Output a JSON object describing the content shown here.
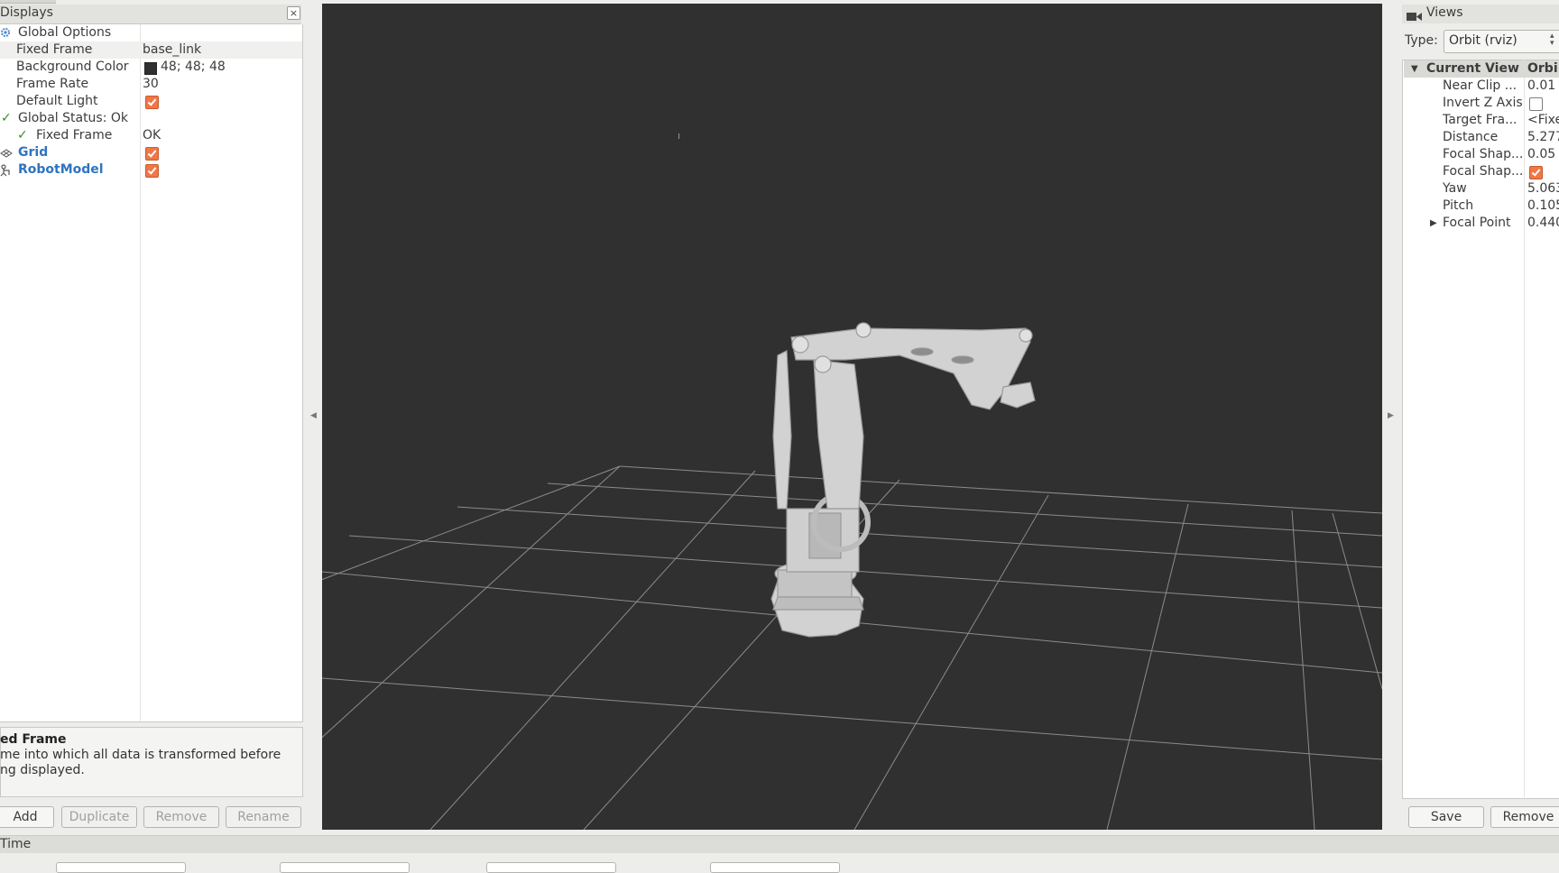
{
  "displays": {
    "title": "Displays",
    "close_icon": "close-icon",
    "rows": {
      "global_options": "Global Options",
      "fixed_frame_label": "Fixed Frame",
      "fixed_frame_value": "base_link",
      "background_color_label": "Background Color",
      "background_color_value": "48; 48; 48",
      "frame_rate_label": "Frame Rate",
      "frame_rate_value": "30",
      "default_light_label": "Default Light",
      "default_light_checked": true,
      "global_status_label": "Global Status: Ok",
      "status_fixed_frame_label": "Fixed Frame",
      "status_fixed_frame_value": "OK",
      "grid_label": "Grid",
      "grid_checked": true,
      "robot_model_label": "RobotModel",
      "robot_model_checked": true
    },
    "description": {
      "title": "ed Frame",
      "line1": "me into which all data is transformed before",
      "line2": "ng displayed."
    },
    "buttons": {
      "add": "Add",
      "duplicate": "Duplicate",
      "remove": "Remove",
      "rename": "Rename"
    }
  },
  "viewport": {
    "background_color": "#303030",
    "grid_color": "#a0a0a0",
    "robot_color": "#d2d2d2"
  },
  "views": {
    "title": "Views",
    "type_label": "Type:",
    "type_value": "Orbit (rviz)",
    "current_view_label": "Current View",
    "current_view_value": "Orbi",
    "properties": [
      {
        "label": "Near Clip ...",
        "value": "0.01"
      },
      {
        "label": "Invert Z Axis",
        "value": ""
      },
      {
        "label": "Target Fra...",
        "value": "<Fixe"
      },
      {
        "label": "Distance",
        "value": "5.277"
      },
      {
        "label": "Focal Shap...",
        "value": "0.05"
      },
      {
        "label": "Focal Shap...",
        "value": ""
      },
      {
        "label": "Yaw",
        "value": "5.063"
      },
      {
        "label": "Pitch",
        "value": "0.105"
      },
      {
        "label": "Focal Point",
        "value": "0.440"
      }
    ],
    "buttons": {
      "save": "Save",
      "remove": "Remove"
    }
  },
  "time": {
    "label": "Time"
  }
}
